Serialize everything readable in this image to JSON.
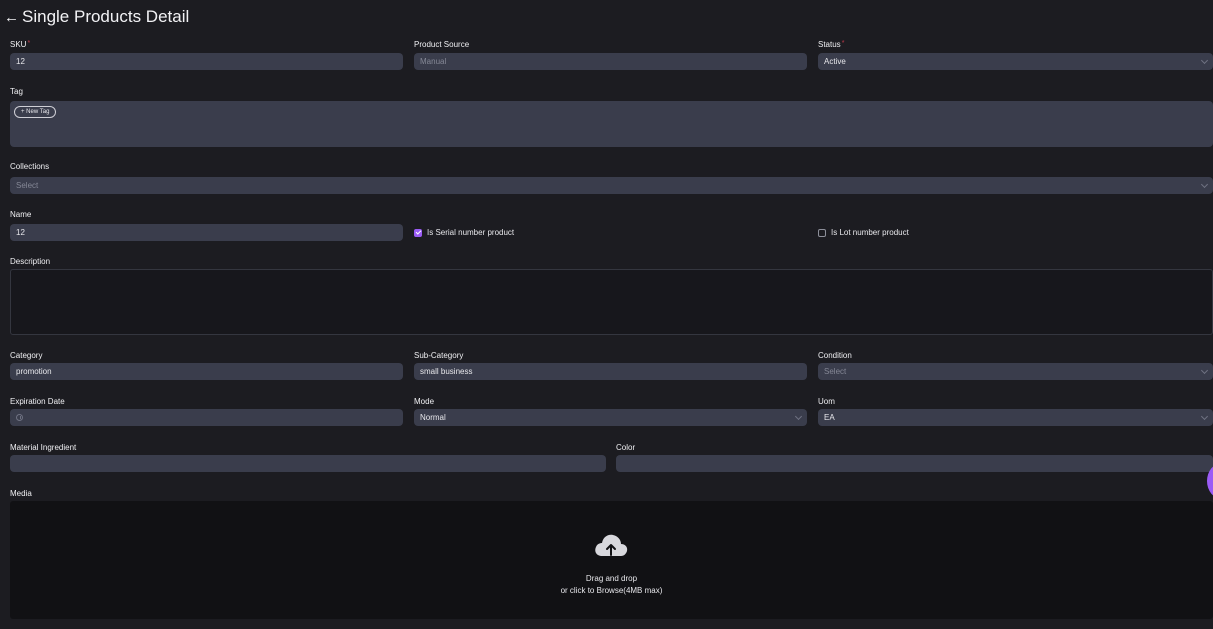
{
  "header": {
    "back_icon": "←",
    "title": "Single Products Detail"
  },
  "sku": {
    "label": "SKU",
    "value": "12"
  },
  "product_source": {
    "label": "Product Source",
    "value": "Manual"
  },
  "status": {
    "label": "Status",
    "value": "Active"
  },
  "tag": {
    "label": "Tag",
    "new_tag_label": "+ New Tag"
  },
  "collections": {
    "label": "Collections",
    "placeholder": "Select"
  },
  "name": {
    "label": "Name",
    "value": "12"
  },
  "serial": {
    "label": "Is Serial number product",
    "checked": true
  },
  "lot": {
    "label": "Is Lot number product",
    "checked": false
  },
  "description": {
    "label": "Description",
    "value": ""
  },
  "category": {
    "label": "Category",
    "value": "promotion"
  },
  "sub_category": {
    "label": "Sub-Category",
    "value": "small business"
  },
  "condition": {
    "label": "Condition",
    "placeholder": "Select"
  },
  "expiration_date": {
    "label": "Expiration Date",
    "icon": "clock-icon"
  },
  "mode": {
    "label": "Mode",
    "value": "Normal"
  },
  "uom": {
    "label": "Uom",
    "value": "EA"
  },
  "material_ingredient": {
    "label": "Material Ingredient",
    "value": ""
  },
  "color": {
    "label": "Color",
    "value": ""
  },
  "media": {
    "label": "Media",
    "icon": "cloud-upload-icon",
    "line1": "Drag and drop",
    "line2": "or click to Browse(4MB max)"
  },
  "colors": {
    "accent": "#9b5cf6",
    "field_bg": "#3a3d4c",
    "page_bg": "#1c1c21",
    "required": "#c0394a"
  }
}
